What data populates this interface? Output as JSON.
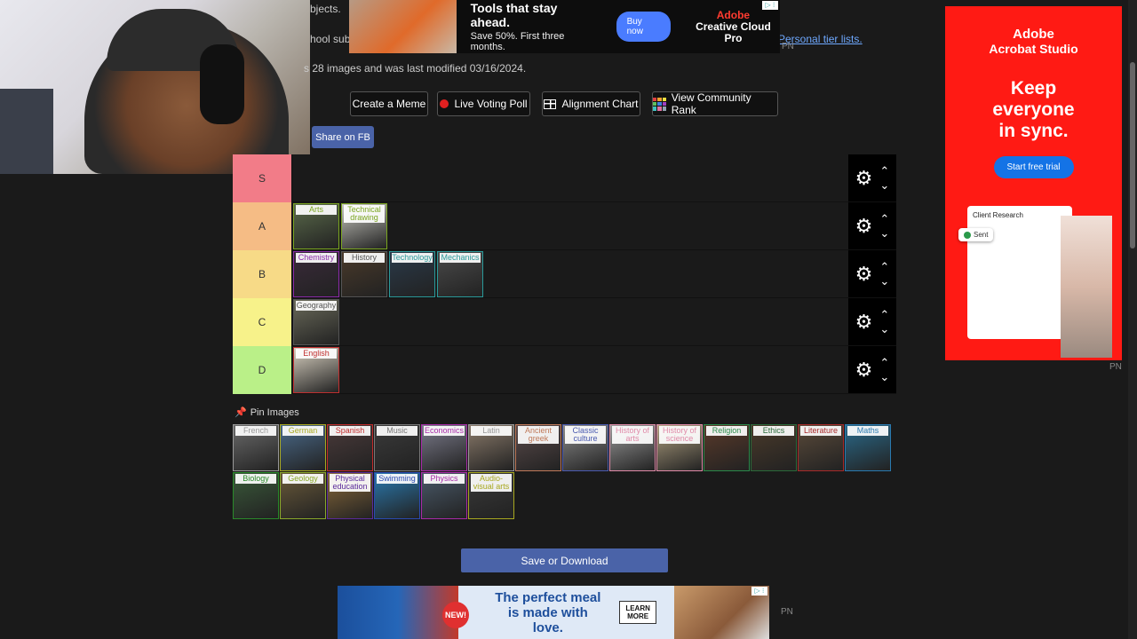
{
  "header": {
    "line1_fragment": "bjects.",
    "line2_fragment": "hool subj",
    "link_personal": "Personal tier lists.",
    "line3": "s 28 images and was last modified 03/16/2024."
  },
  "ad_top": {
    "headline": "Tools that stay ahead.",
    "sub": "Save 50%. First three months.",
    "cta": "Buy now",
    "brand_adobe": "Adobe",
    "brand_product": "Creative Cloud Pro",
    "pn": "PN"
  },
  "actions": {
    "create_meme": "Create a Meme",
    "live_poll": "Live Voting Poll",
    "alignment": "Alignment Chart",
    "community": "View Community Rank",
    "share_fb": "Share on FB"
  },
  "tiers": [
    {
      "label": "S",
      "color": "#f27c88",
      "items": []
    },
    {
      "label": "A",
      "color": "#f5bc85",
      "items": [
        {
          "caption": "Arts",
          "cap_color": "#7aa520",
          "bg": "#5a6a4a"
        },
        {
          "caption": "Technical drawing",
          "cap_color": "#7aa520",
          "bg": "#c8c8c0"
        }
      ]
    },
    {
      "label": "B",
      "color": "#f7da87",
      "items": [
        {
          "caption": "Chemistry",
          "cap_color": "#8a2aa8",
          "bg": "#3a2a3a"
        },
        {
          "caption": "History",
          "cap_color": "#555",
          "bg": "#4a3a2a"
        },
        {
          "caption": "Technology",
          "cap_color": "#2a9a9a",
          "bg": "#2a3a4a"
        },
        {
          "caption": "Mechanics",
          "cap_color": "#2a9a9a",
          "bg": "#4a4a4a"
        }
      ]
    },
    {
      "label": "C",
      "color": "#f7f28a",
      "items": [
        {
          "caption": "Geography",
          "cap_color": "#555",
          "bg": "#6a6a5a"
        }
      ]
    },
    {
      "label": "D",
      "color": "#baf088",
      "items": [
        {
          "caption": "English",
          "cap_color": "#c03030",
          "bg": "#d8d0c0"
        }
      ]
    }
  ],
  "pin_label": "Pin Images",
  "pool": [
    {
      "caption": "French",
      "cap_color": "#999",
      "bg": "#6a6a6a"
    },
    {
      "caption": "German",
      "cap_color": "#a8a820",
      "bg": "#4a6a8a"
    },
    {
      "caption": "Spanish",
      "cap_color": "#c02a2a",
      "bg": "#4a3a3a"
    },
    {
      "caption": "Music",
      "cap_color": "#777",
      "bg": "#3a3a3a"
    },
    {
      "caption": "Economics",
      "cap_color": "#a82aa8",
      "bg": "#7a7a8a"
    },
    {
      "caption": "Latin",
      "cap_color": "#999",
      "bg": "#8a7a6a"
    },
    {
      "caption": "Ancient greek",
      "cap_color": "#c07a5a",
      "bg": "#5a4a4a"
    },
    {
      "caption": "Classic culture",
      "cap_color": "#4a5ab0",
      "bg": "#8a8a8a"
    },
    {
      "caption": "History of arts",
      "cap_color": "#e08aa8",
      "bg": "#9a9a9a"
    },
    {
      "caption": "History of science",
      "cap_color": "#e08aa8",
      "bg": "#b0a080"
    },
    {
      "caption": "Religion",
      "cap_color": "#2a8a4a",
      "bg": "#5a3a2a"
    },
    {
      "caption": "Ethics",
      "cap_color": "#2a6a3a",
      "bg": "#4a3a2a"
    },
    {
      "caption": "Literature",
      "cap_color": "#a82a2a",
      "bg": "#5a4a3a"
    },
    {
      "caption": "Maths",
      "cap_color": "#2a7ab0",
      "bg": "#2a6a8a"
    },
    {
      "caption": "Biology",
      "cap_color": "#2a8a2a",
      "bg": "#3a5a3a"
    },
    {
      "caption": "Geology",
      "cap_color": "#8aa82a",
      "bg": "#6a5a3a"
    },
    {
      "caption": "Physical education",
      "cap_color": "#5a2a9a",
      "bg": "#8a6a3a"
    },
    {
      "caption": "Swimming",
      "cap_color": "#2a4ab0",
      "bg": "#2a7ab0"
    },
    {
      "caption": "Physics",
      "cap_color": "#a82aa8",
      "bg": "#4a5a6a"
    },
    {
      "caption": "Audio-visual arts",
      "cap_color": "#a8a820",
      "bg": "#3a3a3a"
    }
  ],
  "save_button": "Save or Download",
  "ad_bottom": {
    "badge": "NEW!",
    "headline_1": "The perfect meal",
    "headline_2": "is made with love.",
    "cta_1": "LEARN",
    "cta_2": "MORE",
    "pn": "PN"
  },
  "ad_side": {
    "brand_1": "Adobe",
    "brand_2": "Acrobat Studio",
    "headline_1": "Keep",
    "headline_2": "everyone",
    "headline_3": "in sync.",
    "cta": "Start free trial",
    "doc_title": "Client Research",
    "sent": "Sent",
    "pn": "PN"
  },
  "colors": {
    "accent_blue": "#4a63a8",
    "rank_icon": [
      "#e04040",
      "#f0a030",
      "#f0e040",
      "#60c060",
      "#4080e0",
      "#a040c0",
      "#40c0c0",
      "#e070a0",
      "#90a0b0"
    ]
  }
}
